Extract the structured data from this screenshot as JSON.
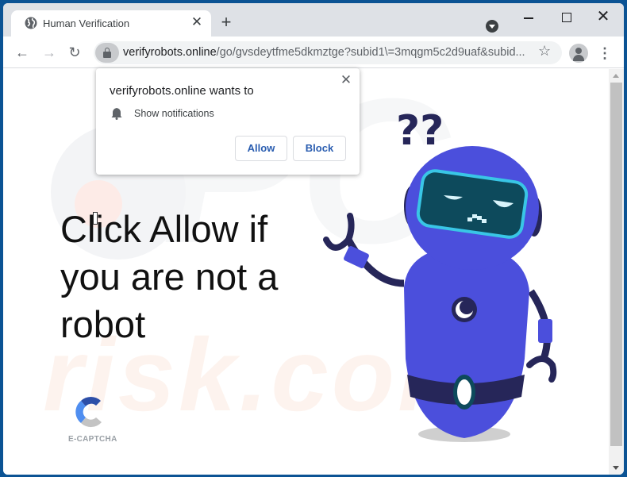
{
  "browser": {
    "tab": {
      "title": "Human Verification",
      "icon": "globe-icon",
      "close_glyph": "✕"
    },
    "new_tab_glyph": "+",
    "window_controls": {
      "close_glyph": "✕"
    },
    "nav": {
      "back_glyph": "←",
      "forward_glyph": "→",
      "reload_glyph": "↻"
    },
    "address": {
      "domain": "verifyrobots.online",
      "path": "/go/gvsdeytfme5dkmztge?subid1\\=3mqgm5c2d9uaf&subid..."
    },
    "star_glyph": "☆",
    "menu_glyph": "⋮"
  },
  "popup": {
    "title": "verifyrobots.online wants to",
    "permission": "Show notifications",
    "close_glyph": "✕",
    "allow_label": "Allow",
    "block_label": "Block"
  },
  "page": {
    "headline": "Click Allow if you are not a robot",
    "captcha_label": "E-CAPTCHA",
    "watermark": "risk.com"
  },
  "colors": {
    "robot_body": "#4b4fdc",
    "robot_dark": "#262659",
    "visor": "#0d4a5c",
    "visor_rim": "#39c6e6",
    "captcha_dark_blue": "#2d4fa8",
    "captcha_blue": "#4f8ef0",
    "captcha_gray": "#c3c3c3",
    "button_text": "#2a5db0"
  }
}
